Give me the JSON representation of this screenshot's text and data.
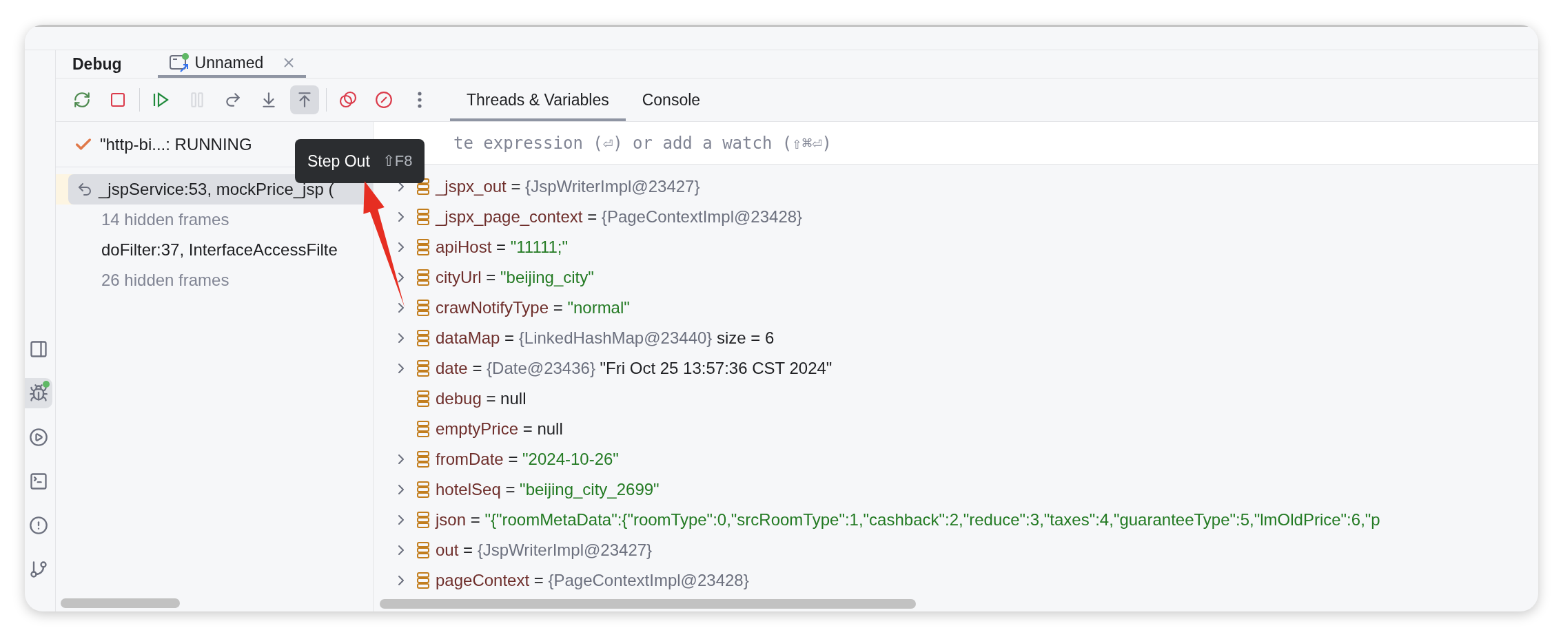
{
  "window": {
    "title": "Debug"
  },
  "session_tabs": [
    {
      "label": "Unnamed",
      "selected": true
    }
  ],
  "toolbar": [
    {
      "buttons": [
        {
          "kind": "rerun",
          "disabled": false,
          "highlighted": false
        },
        {
          "kind": "stop",
          "disabled": false,
          "highlighted": false
        }
      ]
    },
    {
      "buttons": [
        {
          "kind": "resume",
          "disabled": false,
          "highlighted": false
        },
        {
          "kind": "pause",
          "disabled": true,
          "highlighted": false
        },
        {
          "kind": "step-over",
          "disabled": false,
          "highlighted": false
        },
        {
          "kind": "step-into",
          "disabled": false,
          "highlighted": false
        },
        {
          "kind": "step-out",
          "disabled": false,
          "highlighted": true
        }
      ]
    },
    {
      "buttons": [
        {
          "kind": "breakpoints",
          "disabled": false,
          "highlighted": false
        },
        {
          "kind": "mute",
          "disabled": false,
          "highlighted": false
        },
        {
          "kind": "more",
          "disabled": false,
          "highlighted": false
        }
      ]
    }
  ],
  "view_tabs": [
    {
      "label": "Threads & Variables",
      "selected": true
    },
    {
      "label": "Console",
      "selected": false
    }
  ],
  "tool_stripe": [
    {
      "kind": "structure",
      "selected": false
    },
    {
      "kind": "debug",
      "selected": true
    },
    {
      "kind": "run",
      "selected": false
    },
    {
      "kind": "terminal",
      "selected": false
    },
    {
      "kind": "problems",
      "selected": false
    },
    {
      "kind": "git",
      "selected": false
    }
  ],
  "thread": {
    "kind": "ok",
    "label": "\"http-bi...: RUNNING"
  },
  "tooltip": {
    "label": "Step Out",
    "shortcut": "⇧F8"
  },
  "frames": [
    {
      "kind": "frame",
      "label": "_jspService:53, mockPrice_jsp (",
      "selected": true
    },
    {
      "kind": "hidden",
      "label": "14 hidden frames",
      "selected": false
    },
    {
      "kind": "frame",
      "label": "doFilter:37, InterfaceAccessFilte",
      "selected": false
    },
    {
      "kind": "hidden",
      "label": "26 hidden frames",
      "selected": false
    }
  ],
  "eval_field": {
    "placeholder": "te expression (⏎) or add a watch (⇧⌘⏎)"
  },
  "variables": [
    {
      "name": "_jspx_out",
      "op": "=",
      "value": "{JspWriterImpl@23427}",
      "kind": "object",
      "expandable": true
    },
    {
      "name": "_jspx_page_context",
      "op": "=",
      "value": "{PageContextImpl@23428}",
      "kind": "object",
      "expandable": true
    },
    {
      "name": "apiHost",
      "op": "=",
      "value": "\"11111;\"",
      "kind": "string",
      "expandable": true
    },
    {
      "name": "cityUrl",
      "op": "=",
      "value": "\"beijing_city\"",
      "kind": "string",
      "expandable": true
    },
    {
      "name": "crawNotifyType",
      "op": "=",
      "value": "\"normal\"",
      "kind": "string",
      "expandable": true
    },
    {
      "name": "dataMap",
      "op": "=",
      "value": "{LinkedHashMap@23440}",
      "kind": "object",
      "extra": "size = 6",
      "expandable": true
    },
    {
      "name": "date",
      "op": "=",
      "value": "{Date@23436}",
      "kind": "object",
      "extra": "\"Fri Oct 25 13:57:36 CST 2024\"",
      "expandable": true
    },
    {
      "name": "debug",
      "op": "=",
      "value": "null",
      "kind": "plain",
      "expandable": false
    },
    {
      "name": "emptyPrice",
      "op": "=",
      "value": "null",
      "kind": "plain",
      "expandable": false
    },
    {
      "name": "fromDate",
      "op": "=",
      "value": "\"2024-10-26\"",
      "kind": "string",
      "expandable": true
    },
    {
      "name": "hotelSeq",
      "op": "=",
      "value": "\"beijing_city_2699\"",
      "kind": "string",
      "expandable": true
    },
    {
      "name": "json",
      "op": "=",
      "value": "\"{\"roomMetaData\":{\"roomType\":0,\"srcRoomType\":1,\"cashback\":2,\"reduce\":3,\"taxes\":4,\"guaranteeType\":5,\"lmOldPrice\":6,\"p",
      "kind": "string",
      "expandable": true
    },
    {
      "name": "out",
      "op": "=",
      "value": "{JspWriterImpl@23427}",
      "kind": "object",
      "expandable": true
    },
    {
      "name": "pageContext",
      "op": "=",
      "value": "{PageContextImpl@23428}",
      "kind": "object",
      "expandable": true
    }
  ]
}
